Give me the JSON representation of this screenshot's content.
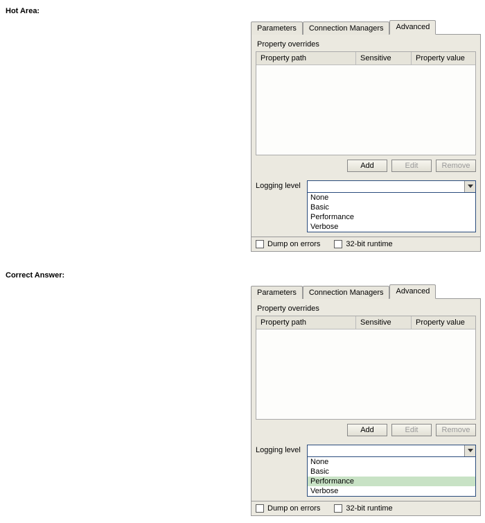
{
  "labels": {
    "hot_area": "Hot Area:",
    "correct_answer": "Correct Answer:"
  },
  "tabs": {
    "parameters": "Parameters",
    "conn_mgr": "Connection Managers",
    "advanced": "Advanced"
  },
  "overrides": {
    "title": "Property overrides",
    "col_path": "Property path",
    "col_sensitive": "Sensitive",
    "col_value": "Property value"
  },
  "buttons": {
    "add": "Add",
    "edit": "Edit",
    "remove": "Remove"
  },
  "logging": {
    "label": "Logging level",
    "options": {
      "none": "None",
      "basic": "Basic",
      "performance": "Performance",
      "verbose": "Verbose"
    },
    "highlighted_answer": "Performance"
  },
  "checks": {
    "dump": "Dump on errors",
    "bit32": "32-bit runtime"
  }
}
